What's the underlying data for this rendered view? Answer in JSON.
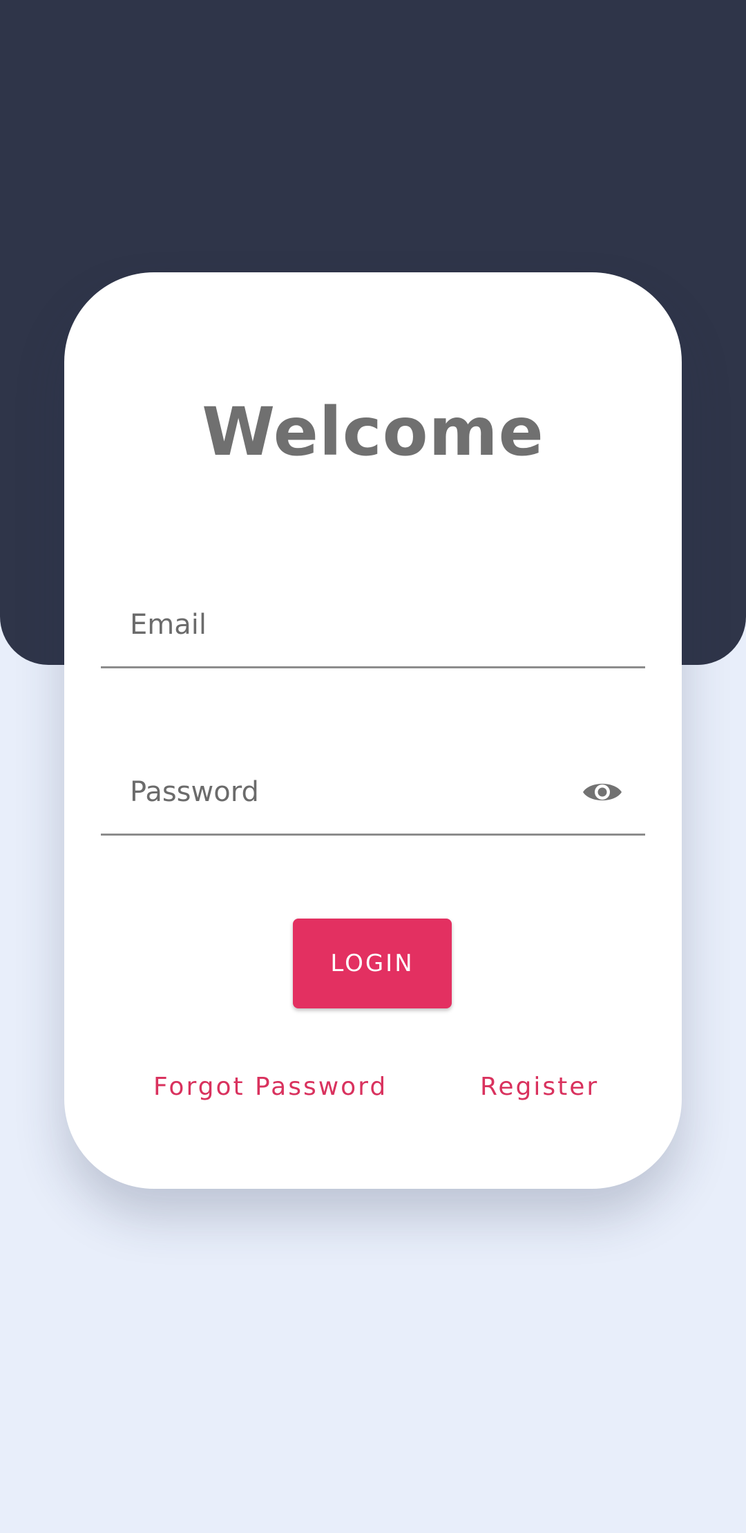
{
  "login": {
    "title": "Welcome",
    "email_placeholder": "Email",
    "email_value": "",
    "password_placeholder": "Password",
    "password_value": "",
    "login_label": "LOGIN",
    "forgot_label": "Forgot Password",
    "register_label": "Register",
    "password_toggle_icon": "eye-icon"
  },
  "colors": {
    "header_background": "#2f3549",
    "page_background": "#e8eefa",
    "card_background": "#ffffff",
    "accent": "#e33061",
    "link": "#d9325e",
    "text_gray": "#707070"
  }
}
